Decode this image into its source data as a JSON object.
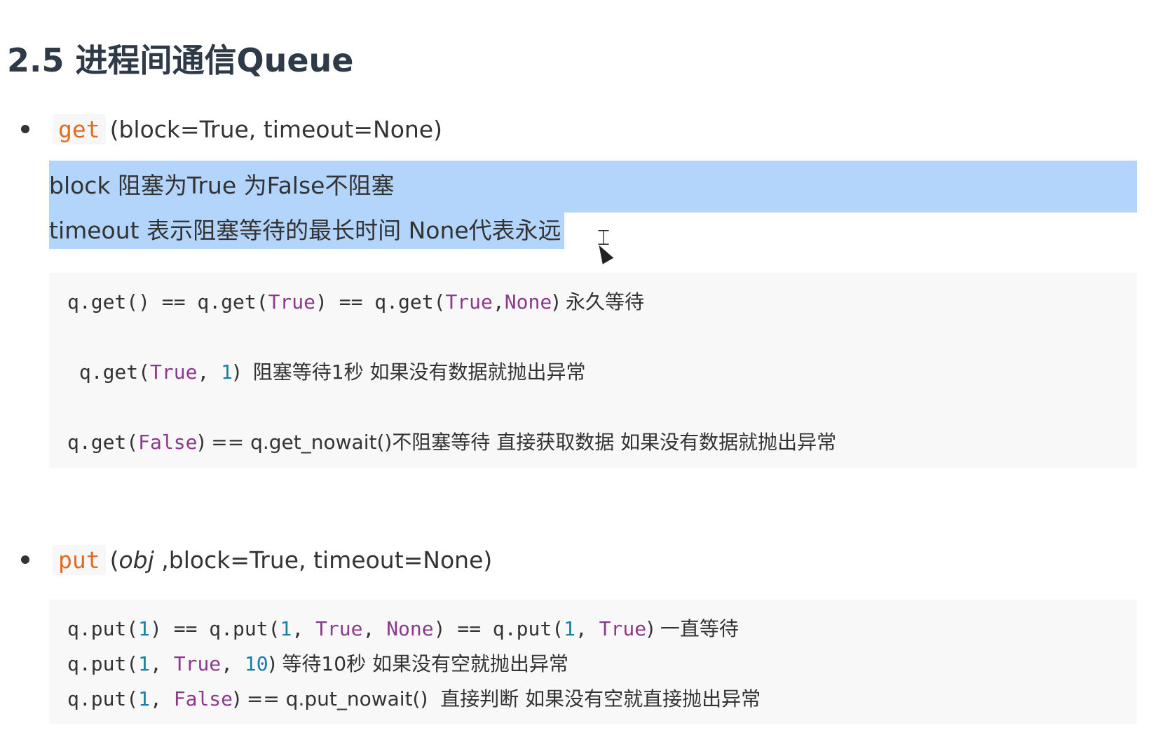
{
  "heading": {
    "number": "2.5",
    "title": "进程间通信Queue"
  },
  "get_section": {
    "name": "get",
    "params": "(block=True, timeout=None)",
    "selected_lines": [
      "block    阻塞为True   为False不阻塞",
      "timeout 表示阻塞等待的最长时间 None代表永远"
    ],
    "code_lines": [
      {
        "prefix": "q.get() == q.get(",
        "kw1": "True",
        "mid1": ") == q.get(",
        "kw2": "True",
        "sep": ",",
        "kw3": "None",
        "suffix": ") 永久等待"
      },
      {
        "prefix": " q.get(",
        "kw1": "True",
        "mid1": ", ",
        "num": "1",
        "suffix": ")  阻塞等待1秒 如果没有数据就抛出异常"
      },
      {
        "prefix": "q.get(",
        "kw1": "False",
        "suffix": ") == q.get_nowait()不阻塞等待 直接获取数据 如果没有数据就抛出异常"
      }
    ]
  },
  "put_section": {
    "name": "put",
    "params_open": "(",
    "params_obj": "obj",
    "params_rest": " ,block=True, timeout=None)",
    "code_lines": [
      {
        "a": "q.put(",
        "n1": "1",
        "b": ") == q.put(",
        "n2": "1",
        "c": ", ",
        "k1": "True",
        "d": ", ",
        "k2": "None",
        "e": ") == q.put(",
        "n3": "1",
        "f": ", ",
        "k3": "True",
        "g": ") 一直等待"
      },
      {
        "a": "q.put(",
        "n1": "1",
        "b": ", ",
        "k1": "True",
        "c": ", ",
        "n2": "10",
        "d": ") 等待10秒 如果没有空就抛出异常"
      },
      {
        "a": "q.put(",
        "n1": "1",
        "b": ", ",
        "k1": "False",
        "c": ") == q.put_nowait()  直接判断 如果没有空就直接抛出异常"
      }
    ]
  },
  "cursor": "I-beam"
}
